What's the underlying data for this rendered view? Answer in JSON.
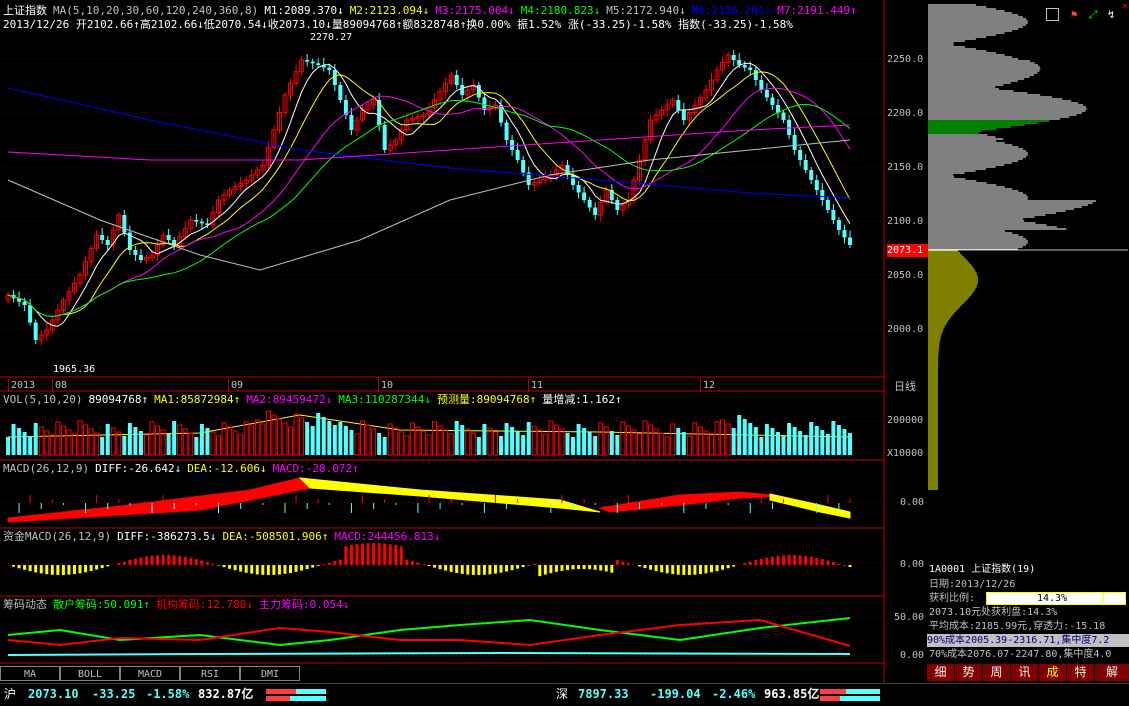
{
  "header": {
    "line1": [
      {
        "text": "上证指数",
        "color": "#ffffff"
      },
      {
        "text": "MA(5,10,20,30,60,120,240,360,8)",
        "color": "#c0c0c0"
      },
      {
        "text": "M1:2089.370↓",
        "color": "#ffffff"
      },
      {
        "text": "M2:2123.094↓",
        "color": "#ffff00"
      },
      {
        "text": "M3:2175.004↓",
        "color": "#ff00ff"
      },
      {
        "text": "M4:2180.823↓",
        "color": "#00ff00"
      },
      {
        "text": "M5:2172.940↓",
        "color": "#c0c0c0"
      },
      {
        "text": "M6:2126.201↓",
        "color": "#0000ff"
      },
      {
        "text": "M7:2191.449↑",
        "color": "#ff00ff"
      }
    ],
    "line2": "2013/12/26 开2102.66↑高2102.66↓低2070.54↓收2073.10↓量89094768↑额8328748↑换0.00% 振1.52% 涨(-33.25)-1.58% 指数(-33.25)-1.58%"
  },
  "main_chart": {
    "price_axis": [
      "2250.0",
      "2200.0",
      "2150.0",
      "2100.0",
      "2073.1",
      "2050.0",
      "2000.0"
    ],
    "high_label": "2270.27",
    "low_label": "1965.36",
    "months": [
      "2013",
      "08",
      "09",
      "10",
      "11",
      "12"
    ],
    "period": "日线"
  },
  "vol_panel": {
    "items": [
      {
        "text": "VOL(5,10,20)",
        "color": "#c0c0c0"
      },
      {
        "text": "89094768↑",
        "color": "#ffffff"
      },
      {
        "text": "MA1:85872984↑",
        "color": "#ffff00"
      },
      {
        "text": "MA2:89459472↓",
        "color": "#ff00ff"
      },
      {
        "text": "MA3:110287344↓",
        "color": "#00ff00"
      },
      {
        "text": "预测量:89094768↑",
        "color": "#ffff00"
      },
      {
        "text": "量增减:1.162↑",
        "color": "#ffffff"
      }
    ],
    "axis": [
      "200000",
      "X10000"
    ]
  },
  "macd_panel": {
    "items": [
      {
        "text": "MACD(26,12,9)",
        "color": "#c0c0c0"
      },
      {
        "text": "DIFF:-26.642↓",
        "color": "#ffffff"
      },
      {
        "text": "DEA:-12.606↓",
        "color": "#ffff00"
      },
      {
        "text": "MACD:-28.072↑",
        "color": "#ff00ff"
      }
    ],
    "axis": [
      "0.00"
    ]
  },
  "fund_macd_panel": {
    "items": [
      {
        "text": "资金MACD(26,12,9)",
        "color": "#c0c0c0"
      },
      {
        "text": "DIFF:-386273.5↓",
        "color": "#ffffff"
      },
      {
        "text": "DEA:-508501.906↑",
        "color": "#ffff00"
      },
      {
        "text": "MACD:244456.813↓",
        "color": "#ff00ff"
      }
    ],
    "axis": [
      "0.00"
    ]
  },
  "chip_panel": {
    "items": [
      {
        "text": "筹码动态",
        "color": "#c0c0c0"
      },
      {
        "text": "散户筹码:50.091↑",
        "color": "#00ff00"
      },
      {
        "text": "机构筹码:12.780↓",
        "color": "#ff0000"
      },
      {
        "text": "主力筹码:0.054↓",
        "color": "#ff00ff"
      }
    ],
    "axis": [
      "50.00",
      "0.00"
    ]
  },
  "tabs": [
    "MA",
    "BOLL",
    "MACD",
    "RSI",
    "DMI"
  ],
  "right_panel": {
    "code_line": "1A0001 上证指数(19)",
    "date_line": "日期:2013/12/26",
    "profit_label": "获利比例:",
    "profit_value": "14.3%",
    "profit_ratio": 0.143,
    "line_profit": "2073.10元处获利盘:14.3%",
    "line_cost": "平均成本:2185.99元,穿透力:-15.18",
    "line_90": "90%成本2005.39-2316.71,集中度7.2",
    "line_70": "70%成本2076.07-2247.80,集中度4.0",
    "buttons": [
      "细",
      "势",
      "周",
      "讯",
      "成",
      "特",
      "解"
    ],
    "top_icons": [
      "toolbar-box-icon",
      "flag-icon",
      "fullscreen-icon",
      "refresh-icon",
      "close-icon"
    ]
  },
  "statusbar": {
    "sh_label": "沪",
    "sh_price": "2073.10",
    "sh_change": "-33.25",
    "sh_pct": "-1.58%",
    "sh_amount": "832.87亿",
    "sz_label": "深",
    "sz_price": "7897.33",
    "sz_change": "-199.04",
    "sz_pct": "-2.46%",
    "sz_amount": "963.85亿"
  },
  "colors": {
    "up": "#ff0000",
    "down": "#54ffff",
    "ma1": "#ffffff",
    "ma2": "#ffff00",
    "ma3": "#ff00ff",
    "ma4": "#00ff00",
    "ma5": "#c0c0c0",
    "ma6": "#0000ff",
    "grid": "#800000",
    "axis": "#c00000"
  }
}
